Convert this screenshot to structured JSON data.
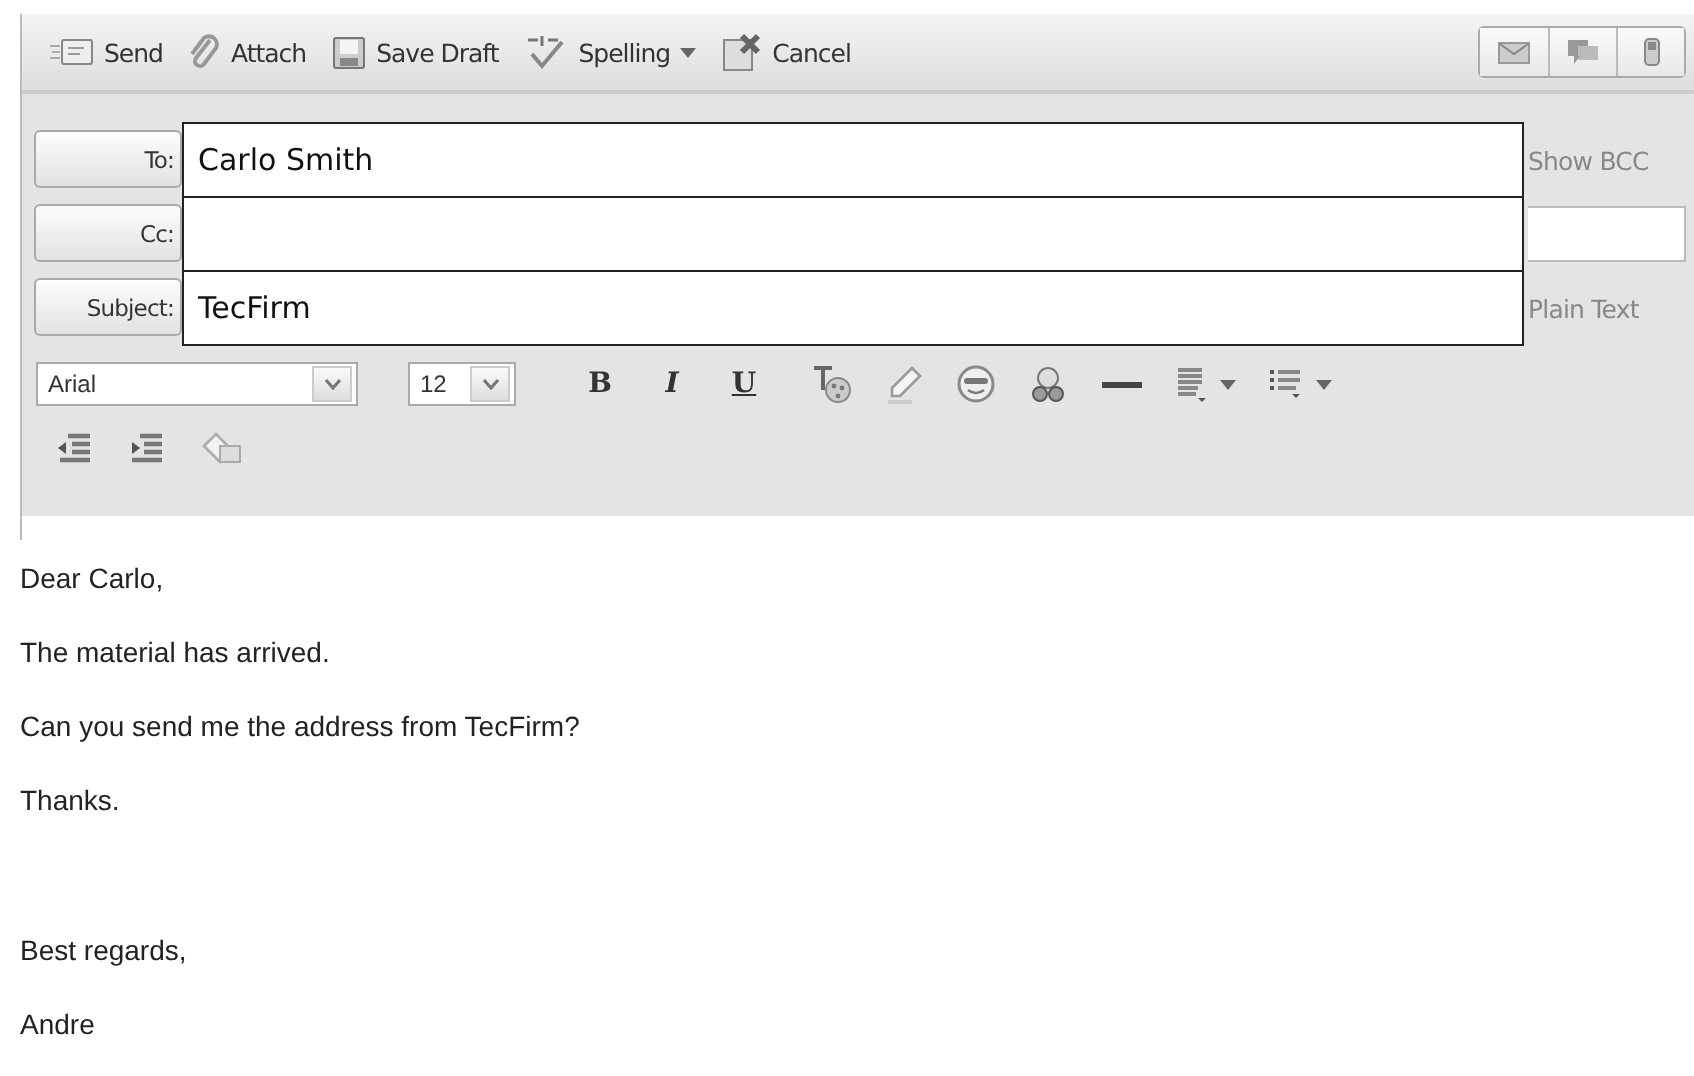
{
  "toolbar": {
    "buttons": [
      {
        "kind": "send",
        "label": "Send",
        "dropdown": false
      },
      {
        "kind": "attach",
        "label": "Attach",
        "dropdown": false
      },
      {
        "kind": "save",
        "label": "Save Draft",
        "dropdown": false
      },
      {
        "kind": "spelling",
        "label": "Spelling",
        "dropdown": true
      },
      {
        "kind": "cancel",
        "label": "Cancel",
        "dropdown": false
      }
    ],
    "mode_buttons": [
      {
        "kind": "email"
      },
      {
        "kind": "chat"
      },
      {
        "kind": "phone"
      }
    ]
  },
  "header_fields": [
    {
      "label": "To:",
      "value": "Carlo Smith",
      "side": {
        "kind": "link",
        "text": "Show BCC"
      }
    },
    {
      "label": "Cc:",
      "side": {
        "kind": "field"
      }
    },
    {
      "label": "Subject:",
      "value": "TecFirm",
      "side": {
        "kind": "link",
        "text": "Plain Text"
      }
    }
  ],
  "format_bar": {
    "font": "Arial",
    "size": "12",
    "styles": [
      {
        "kind": "bold",
        "label": "B"
      },
      {
        "kind": "italic",
        "label": "I"
      },
      {
        "kind": "underline",
        "label": "U"
      }
    ],
    "tools": [
      {
        "kind": "text-color"
      },
      {
        "kind": "highlight"
      },
      {
        "kind": "emoji"
      },
      {
        "kind": "more-emoji"
      },
      {
        "kind": "rule"
      },
      {
        "kind": "align",
        "dropdown": true
      },
      {
        "kind": "list",
        "dropdown": true
      }
    ],
    "tools_row2": [
      {
        "kind": "outdent"
      },
      {
        "kind": "indent"
      },
      {
        "kind": "clear"
      }
    ]
  },
  "body": [
    [
      "Dear Carlo,",
      "The material has arrived.",
      "Can you send me the address from TecFirm?",
      "Thanks."
    ],
    [
      "Best regards,",
      "Andre"
    ]
  ]
}
